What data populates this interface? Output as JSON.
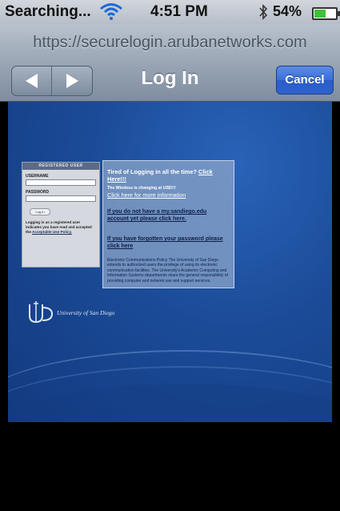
{
  "status_bar": {
    "carrier": "Searching...",
    "time": "4:51 PM",
    "battery_percent": "54%",
    "battery_level": 0.54
  },
  "nav": {
    "url": "https://securelogin.arubanetworks.com",
    "title": "Log In",
    "cancel_label": "Cancel"
  },
  "page": {
    "login_box": {
      "header": "REGISTERED USER",
      "username_label": "USERNAME",
      "password_label": "PASSWORD",
      "login_button": "Log In",
      "note_text": "Logging in as a registered user indicates you have read and accepted the",
      "note_link": "Acceptable Use Policy."
    },
    "info_box": {
      "tired_text": "Tired of Logging in all the time?",
      "tired_link": "Click Here!!!",
      "changing_text": "The Wireless is changing at USD!!!",
      "more_info_link": "Click here for more information",
      "no_account_link": "If you do not have a my.sandiego.edu account yet please click here.",
      "forgot_link": "If you have forgotten your password please click here",
      "policy_text": "Electronic Communications Policy The University of San Diego extends to authorized users the privilege of using its electronic communication facilities. The University's Academic Computing and Information Systems departments share the general responsibility of providing computer and network use and support services."
    },
    "logo_text": "University of San Diego"
  },
  "icons": {
    "wifi": "wifi-icon",
    "bluetooth": "bluetooth-icon",
    "battery": "battery-icon",
    "back": "back-arrow-icon",
    "forward": "forward-arrow-icon"
  },
  "colors": {
    "accent_button": "#3b6fd8",
    "page_background": "#1b4b98"
  }
}
